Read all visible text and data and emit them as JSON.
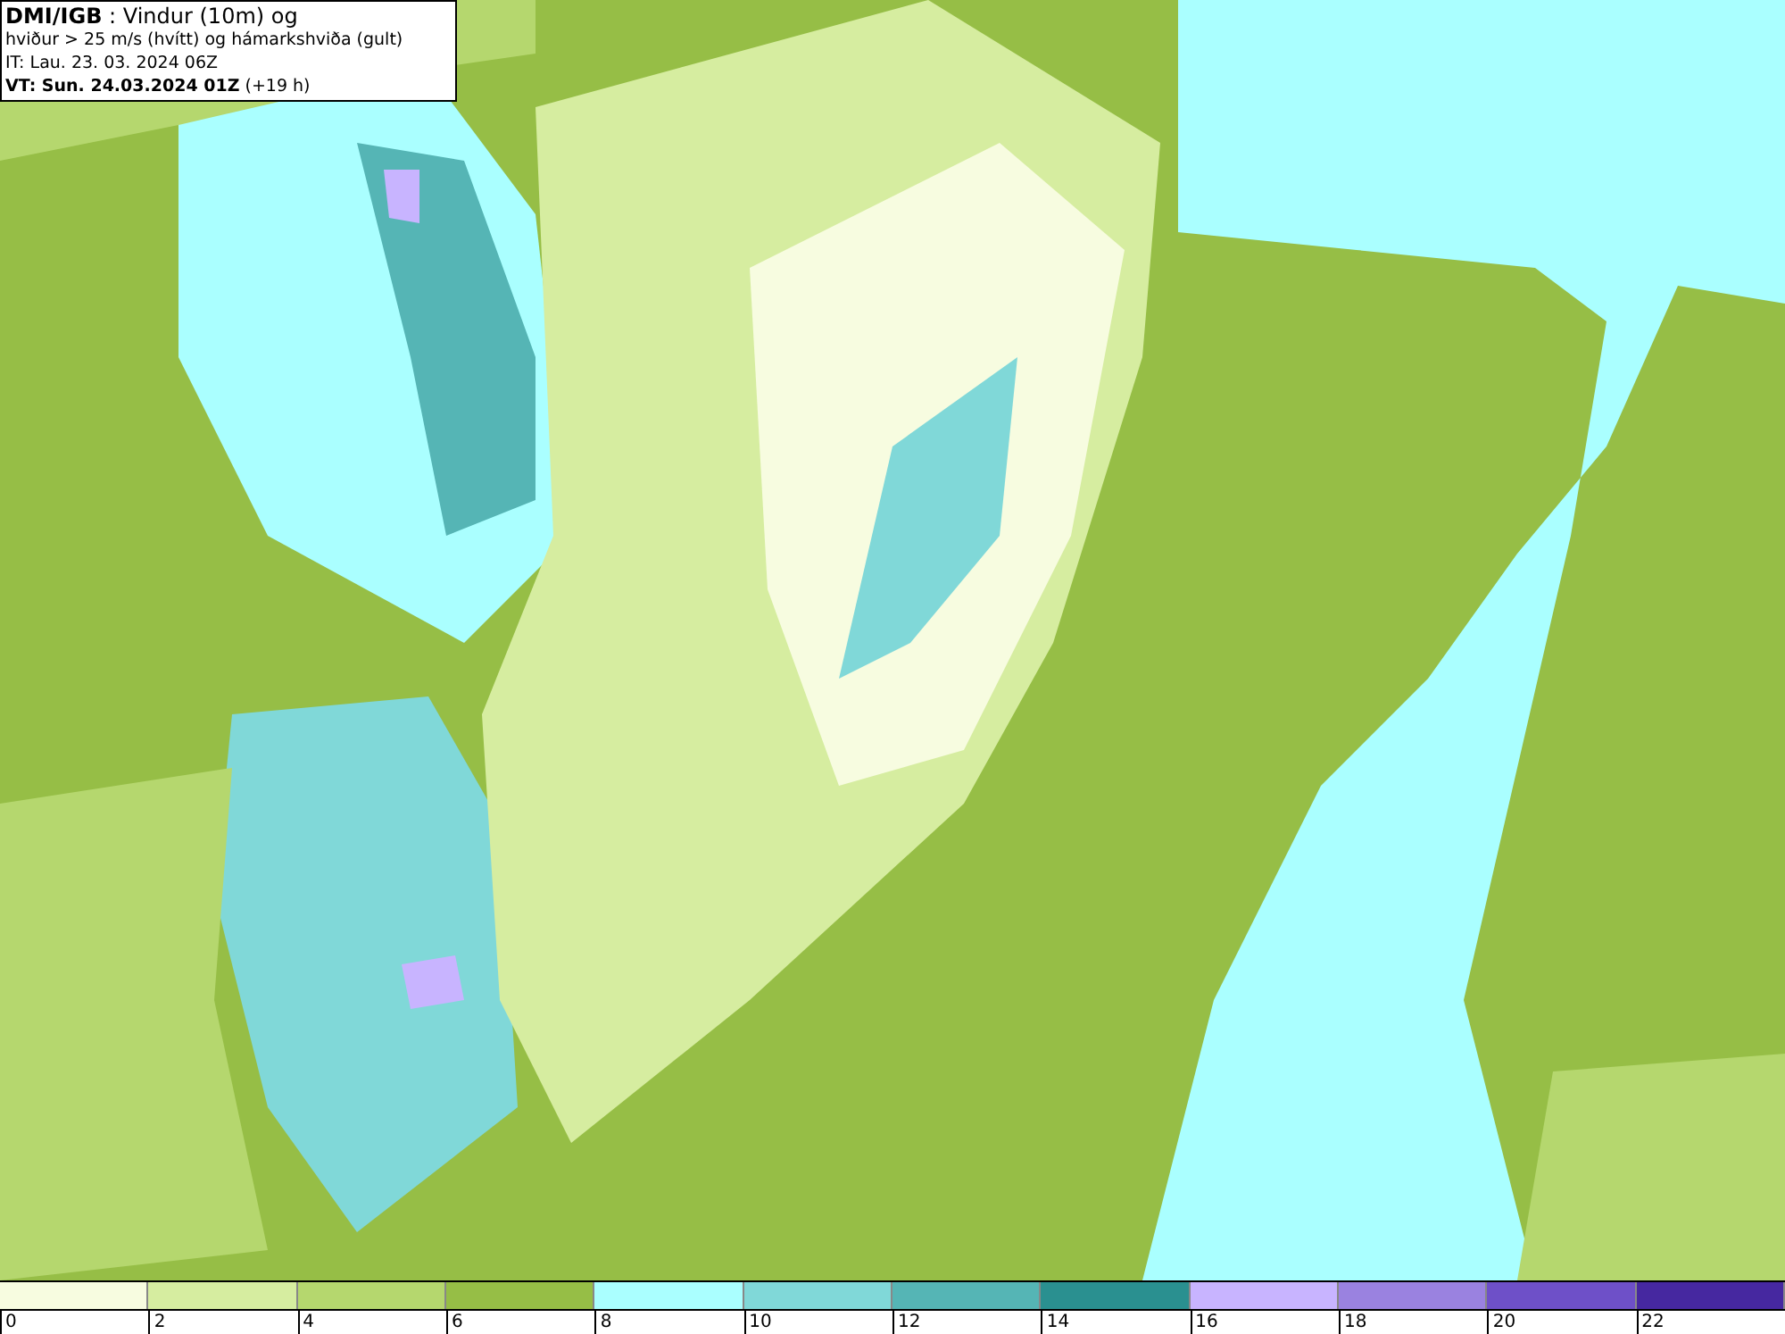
{
  "header": {
    "lines": [
      "**DMI/IGB** : Vindur (10m) og",
      "hviður > 25 m/s (hvítt) og hámarkshviða (gult)",
      "IT: Lau. 23. 03. 2024 06Z",
      "**VT: Sun. 24.03.2024 01Z** (+19 h)"
    ]
  },
  "legend": {
    "bins": [
      {
        "label": "0",
        "color": "#f7fce0"
      },
      {
        "label": "2",
        "color": "#d6eda0"
      },
      {
        "label": "4",
        "color": "#b5d76e"
      },
      {
        "label": "6",
        "color": "#96be46"
      },
      {
        "label": "8",
        "color": "#aaffff"
      },
      {
        "label": "10",
        "color": "#80d8d8"
      },
      {
        "label": "12",
        "color": "#55b5b5"
      },
      {
        "label": "14",
        "color": "#2a9090"
      },
      {
        "label": "16",
        "color": "#c8b4ff"
      },
      {
        "label": "18",
        "color": "#9a82e0"
      },
      {
        "label": "20",
        "color": "#6e50c8"
      },
      {
        "label": "22",
        "color": "#4628a0"
      }
    ]
  }
}
